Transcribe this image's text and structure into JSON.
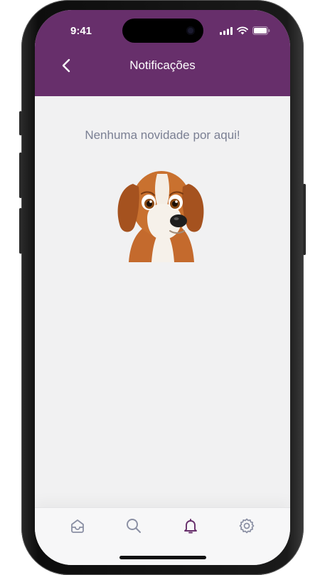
{
  "status_bar": {
    "time": "9:41"
  },
  "header": {
    "title": "Notificações"
  },
  "empty_state": {
    "message": "Nenhuma novidade por aqui!"
  },
  "colors": {
    "brand": "#672f6b",
    "background": "#f1f1f2",
    "muted_text": "#7a7f93",
    "tab_active": "#672f6b",
    "tab_inactive": "#8a8fa3"
  },
  "tabs": [
    {
      "icon": "inbox-icon",
      "active": false
    },
    {
      "icon": "search-icon",
      "active": false
    },
    {
      "icon": "bell-icon",
      "active": true
    },
    {
      "icon": "gear-icon",
      "active": false
    }
  ]
}
